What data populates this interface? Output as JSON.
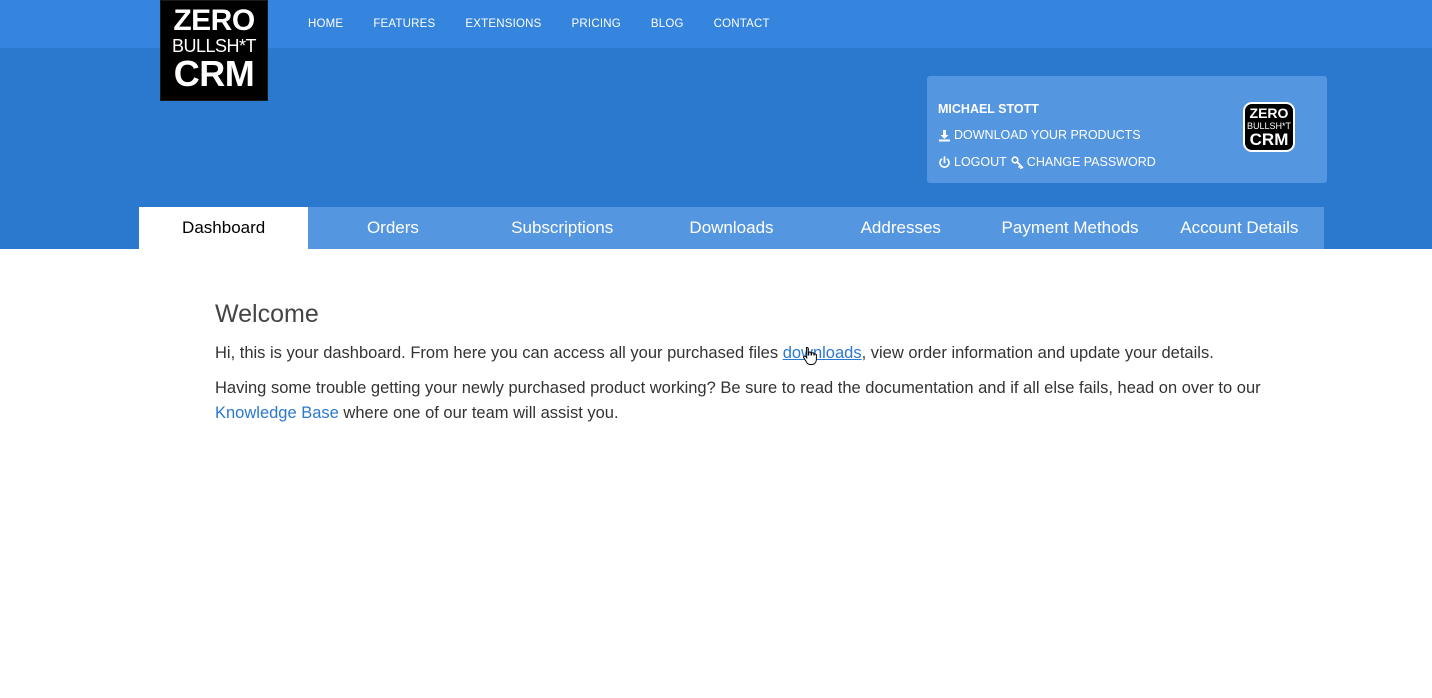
{
  "logo": {
    "line1": "ZERO",
    "line2": "BULLSH*T",
    "line3": "CRM"
  },
  "nav": [
    "HOME",
    "FEATURES",
    "EXTENSIONS",
    "PRICING",
    "BLOG",
    "CONTACT"
  ],
  "user": {
    "name": "MICHAEL STOTT",
    "download_label": "DOWNLOAD YOUR PRODUCTS",
    "logout_label": "LOGOUT",
    "change_password_label": "CHANGE PASSWORD"
  },
  "mini_logo": {
    "line1": "ZERO",
    "line2": "BULLSH*T",
    "line3": "CRM"
  },
  "tabs": [
    "Dashboard",
    "Orders",
    "Subscriptions",
    "Downloads",
    "Addresses",
    "Payment Methods",
    "Account Details"
  ],
  "active_tab": "Dashboard",
  "content": {
    "title": "Welcome",
    "p1_before": "Hi, this is your dashboard. From here you can access all your purchased files ",
    "p1_link": "downloads",
    "p1_after": ", view order information and update your details.",
    "p2_before": "Having some trouble getting your newly purchased product working? Be sure to read the documentation and if all else fails, head on over to our ",
    "p2_link": "Knowledge Base",
    "p2_after": " where one of our team will assist you."
  },
  "colors": {
    "header_blue": "#3584dd",
    "hero_blue": "#2b78cf",
    "panel_blue": "#5596e0",
    "link": "#2b78cf"
  }
}
